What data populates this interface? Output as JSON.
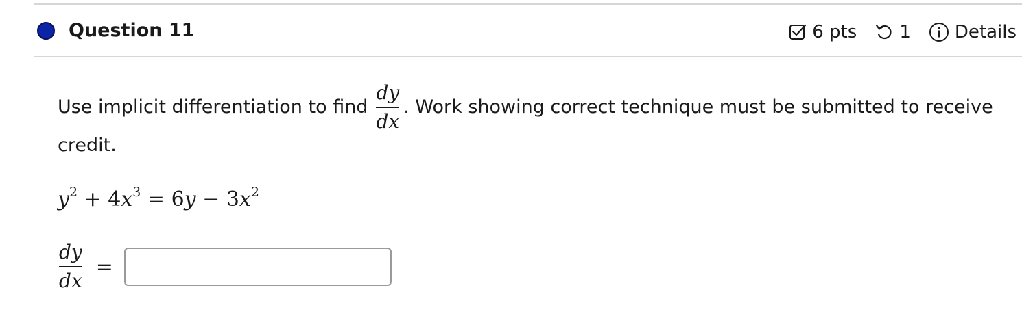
{
  "question": {
    "title": "Question 11",
    "status_color": "#0c24a6"
  },
  "meta": {
    "points_icon": "checkbox-icon",
    "points": "6 pts",
    "attempts_icon": "undo-icon",
    "attempts": "1",
    "details_icon": "info-icon",
    "details": "Details"
  },
  "prompt": {
    "before": "Use implicit differentiation to find",
    "frac_num": "dy",
    "frac_den": "dx",
    "after": ". Work showing correct technique must be submitted to receive",
    "continuation": "credit."
  },
  "equation": {
    "lhs_a": "y",
    "lhs_a_exp": "2",
    "plus": " + 4",
    "lhs_b": "x",
    "lhs_b_exp": "3",
    "equals": " = 6",
    "rhs_a": "y",
    "minus": " − 3",
    "rhs_b": "x",
    "rhs_b_exp": "2"
  },
  "answer": {
    "frac_num": "dy",
    "frac_den": "dx",
    "equals": "=",
    "value": ""
  }
}
